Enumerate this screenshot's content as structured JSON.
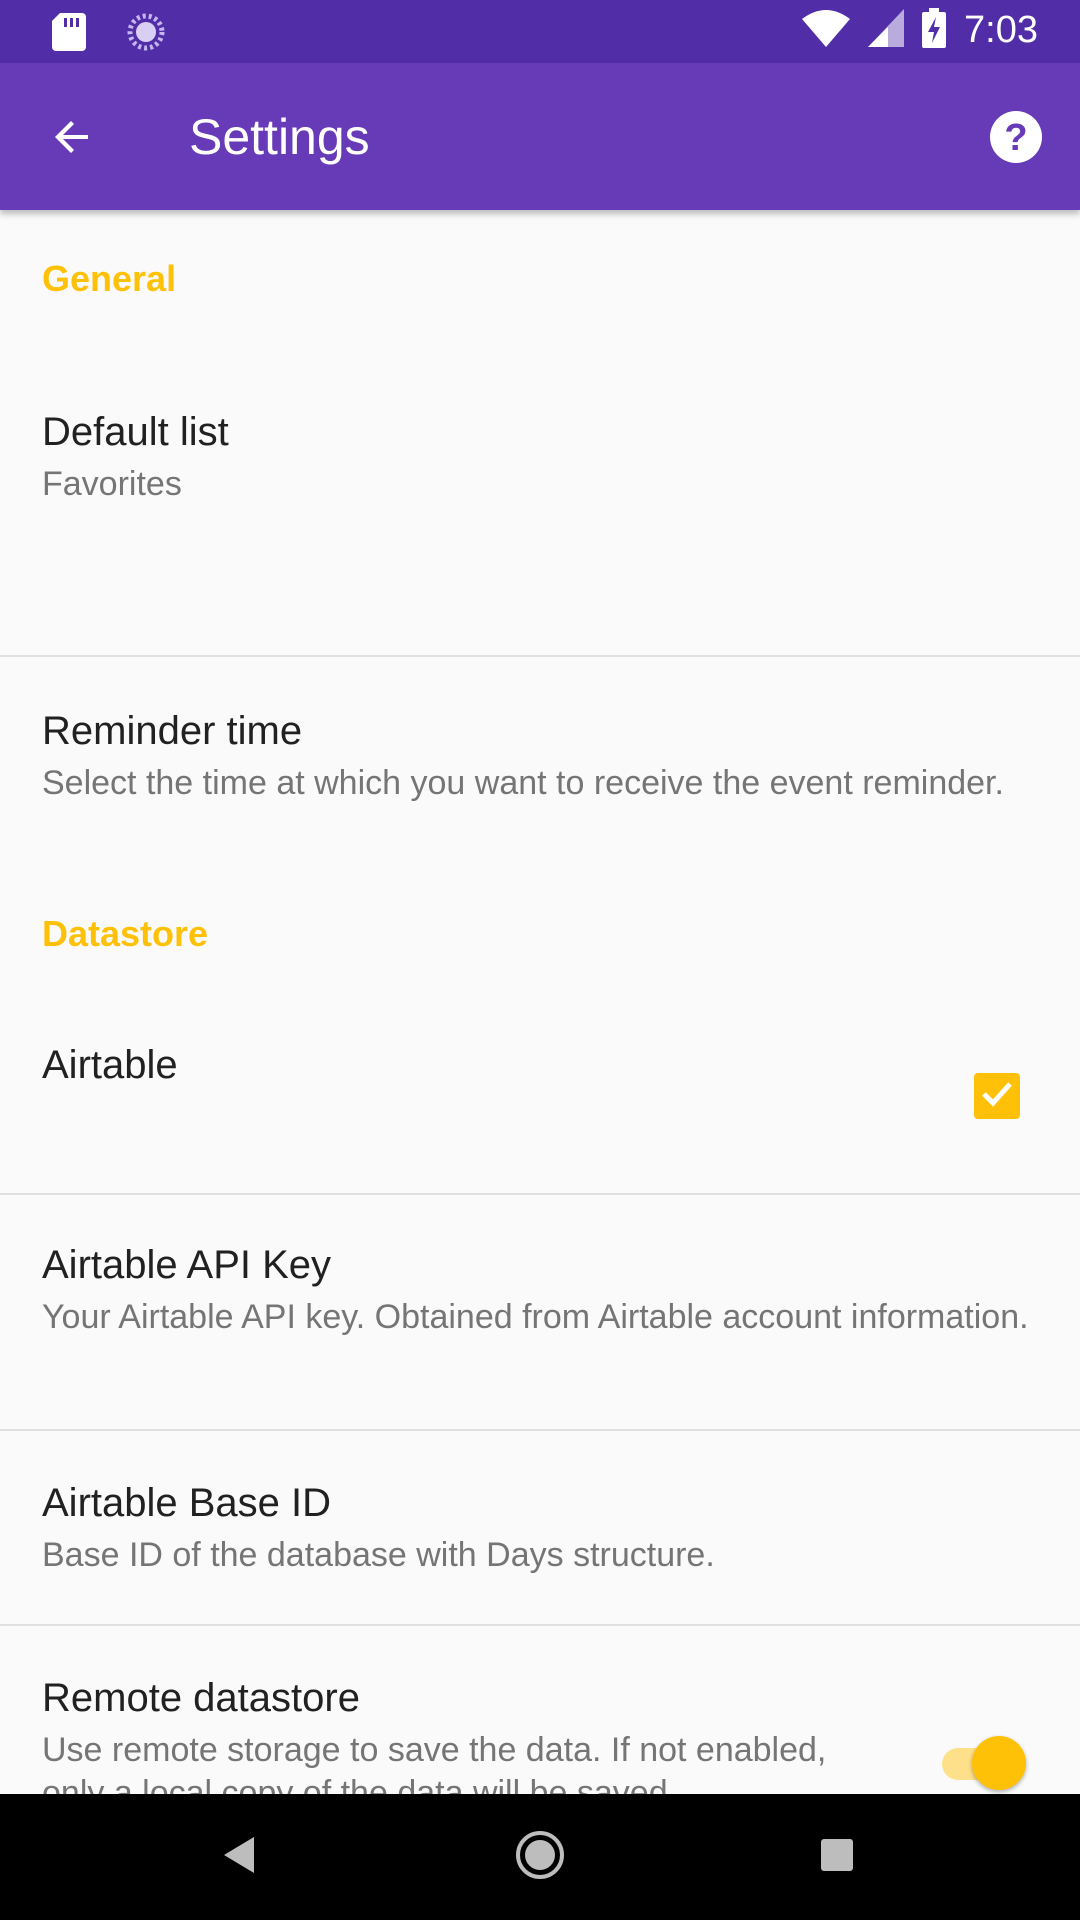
{
  "status_bar": {
    "time": "7:03",
    "icons": [
      "sd-card-icon",
      "sync-icon",
      "wifi-icon",
      "cell-signal-icon",
      "battery-charging-icon"
    ]
  },
  "app_bar": {
    "title": "Settings",
    "back_icon": "arrow-back-icon",
    "help_icon": "help-icon",
    "color": "#673ab7"
  },
  "sections": {
    "general": {
      "header": "General",
      "default_list": {
        "title": "Default list",
        "summary": "Favorites"
      },
      "reminder_time": {
        "title": "Reminder time",
        "summary": "Select the time at which you want to receive the event reminder."
      }
    },
    "datastore": {
      "header": "Datastore",
      "airtable": {
        "title": "Airtable",
        "checked": true
      },
      "api_key": {
        "title": "Airtable API Key",
        "summary": "Your Airtable API key. Obtained from Airtable account information."
      },
      "base_id": {
        "title": "Airtable Base ID",
        "summary": "Base ID of the database with Days structure."
      },
      "remote": {
        "title": "Remote datastore",
        "summary": "Use remote storage to save the data. If not enabled, only a local copy of the data will be saved.",
        "enabled": true
      }
    }
  },
  "accent_color": "#ffc107",
  "nav_bar": {
    "icons": [
      "nav-back-icon",
      "nav-home-icon",
      "nav-recents-icon"
    ]
  }
}
